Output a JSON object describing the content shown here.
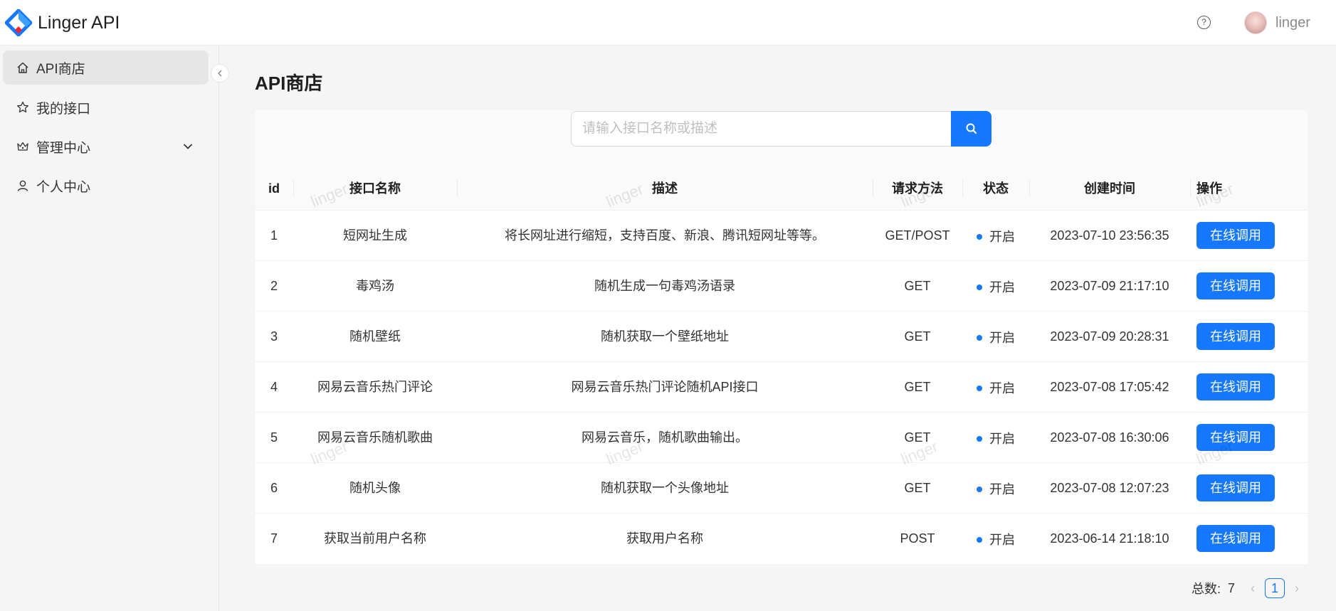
{
  "app": {
    "title": "Linger API"
  },
  "header": {
    "help_icon": "question-circle-icon",
    "username": "linger"
  },
  "sidebar": {
    "items": [
      {
        "label": "API商店",
        "icon": "home-icon",
        "active": true
      },
      {
        "label": "我的接口",
        "icon": "star-icon",
        "active": false
      },
      {
        "label": "管理中心",
        "icon": "crown-icon",
        "active": false,
        "expandable": true
      },
      {
        "label": "个人中心",
        "icon": "user-icon",
        "active": false
      }
    ]
  },
  "page": {
    "title": "API商店"
  },
  "search": {
    "placeholder": "请输入接口名称或描述",
    "value": ""
  },
  "table": {
    "columns": [
      "id",
      "接口名称",
      "描述",
      "请求方法",
      "状态",
      "创建时间",
      "操作"
    ],
    "rows": [
      {
        "id": "1",
        "name": "短网址生成",
        "desc": "将长网址进行缩短，支持百度、新浪、腾讯短网址等等。",
        "method": "GET/POST",
        "status": "开启",
        "created": "2023-07-10 23:56:35",
        "action": "在线调用"
      },
      {
        "id": "2",
        "name": "毒鸡汤",
        "desc": "随机生成一句毒鸡汤语录",
        "method": "GET",
        "status": "开启",
        "created": "2023-07-09 21:17:10",
        "action": "在线调用"
      },
      {
        "id": "3",
        "name": "随机壁纸",
        "desc": "随机获取一个壁纸地址",
        "method": "GET",
        "status": "开启",
        "created": "2023-07-09 20:28:31",
        "action": "在线调用"
      },
      {
        "id": "4",
        "name": "网易云音乐热门评论",
        "desc": "网易云音乐热门评论随机API接口",
        "method": "GET",
        "status": "开启",
        "created": "2023-07-08 17:05:42",
        "action": "在线调用"
      },
      {
        "id": "5",
        "name": "网易云音乐随机歌曲",
        "desc": "网易云音乐，随机歌曲输出。",
        "method": "GET",
        "status": "开启",
        "created": "2023-07-08 16:30:06",
        "action": "在线调用"
      },
      {
        "id": "6",
        "name": "随机头像",
        "desc": "随机获取一个头像地址",
        "method": "GET",
        "status": "开启",
        "created": "2023-07-08 12:07:23",
        "action": "在线调用"
      },
      {
        "id": "7",
        "name": "获取当前用户名称",
        "desc": "获取用户名称",
        "method": "POST",
        "status": "开启",
        "created": "2023-06-14 21:18:10",
        "action": "在线调用"
      }
    ]
  },
  "pagination": {
    "total_label": "总数:",
    "total": "7",
    "current_page": "1"
  },
  "watermark": "linger",
  "colors": {
    "primary": "#1677ff",
    "background": "#f5f5f5"
  }
}
